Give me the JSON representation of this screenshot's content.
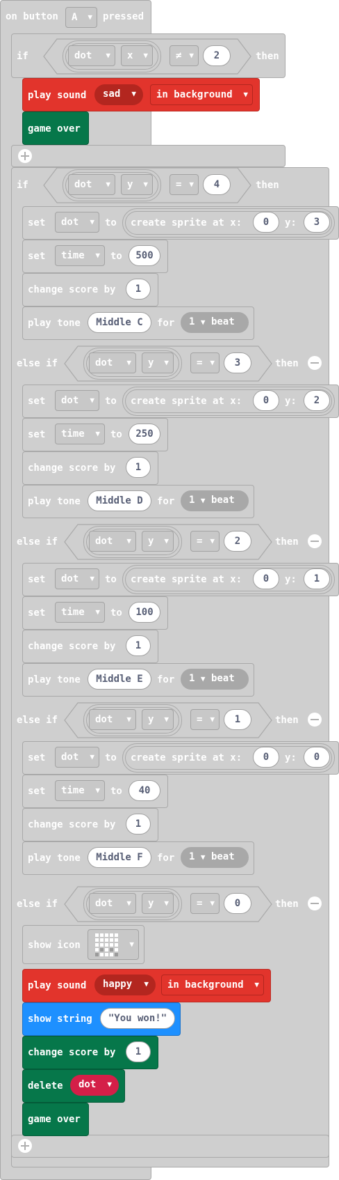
{
  "event": {
    "on_button": "on button",
    "button": "A",
    "pressed": "pressed"
  },
  "kw": {
    "if": "if",
    "then": "then",
    "else_if": "else if",
    "set": "set",
    "to": "to",
    "change": "change",
    "score": "score",
    "by": "by",
    "play_tone": "play tone",
    "for": "for",
    "beat": "beat",
    "create_sprite": "create sprite at x:",
    "y_colon": "y:",
    "play_sound": "play sound",
    "in_background": "in background",
    "game_over": "game over",
    "show_icon": "show icon",
    "show_string": "show string",
    "delete": "delete"
  },
  "vars": {
    "dot": "dot",
    "time": "time"
  },
  "props": {
    "x": "x",
    "y": "y"
  },
  "first_if": {
    "op": "≠",
    "value": "2",
    "sound": "sad"
  },
  "branches": [
    {
      "compare": "4",
      "x": "0",
      "y": "3",
      "time": "500",
      "score": "1",
      "note": "Middle C",
      "beats": "1"
    },
    {
      "compare": "3",
      "x": "0",
      "y": "2",
      "time": "250",
      "score": "1",
      "note": "Middle D",
      "beats": "1"
    },
    {
      "compare": "2",
      "x": "0",
      "y": "1",
      "time": "100",
      "score": "1",
      "note": "Middle E",
      "beats": "1"
    },
    {
      "compare": "1",
      "x": "0",
      "y": "0",
      "time": "40",
      "score": "1",
      "note": "Middle F",
      "beats": "1"
    }
  ],
  "eq_op": "=",
  "last_branch": {
    "compare": "0",
    "sound": "happy",
    "string": "\"You won!\"",
    "score": "1"
  },
  "colors": {
    "block_gray": "#cfcfcf",
    "sound_red": "#e2342c",
    "game_green": "#06774a",
    "text_blue": "#1e90ff",
    "sprite_crimson": "#d41f48"
  }
}
